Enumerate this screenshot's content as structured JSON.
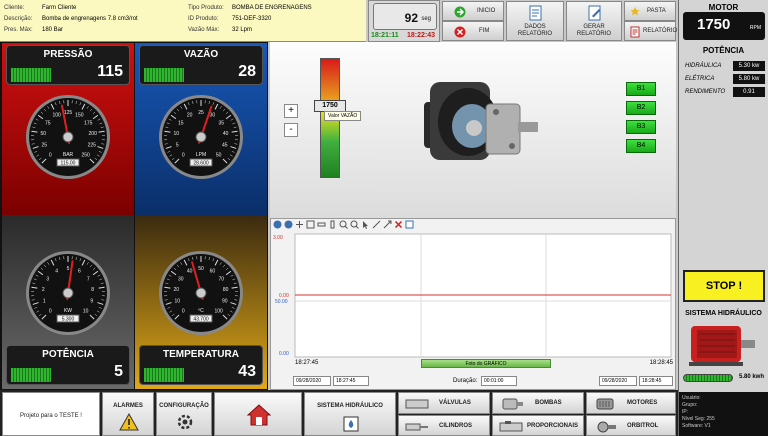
{
  "header": {
    "cliente_label": "Cliente:",
    "cliente": "Farm Cliente",
    "descricao_label": "Descrição:",
    "descricao": "Bomba de engrenagens 7.8 cm3/rot",
    "pres_label": "Pres. Máx:",
    "pres": "180 Bar",
    "tipo_label": "Tipo Produto:",
    "tipo": "BOMBA DE ENGRENAGENS",
    "id_label": "ID Produto:",
    "id": "751-DEF-3320",
    "vazao_label": "Vazão Máx:",
    "vazao": "32 Lpm"
  },
  "timer": {
    "value": "92",
    "unit": "seg",
    "start": "18:21:11",
    "end": "18:22:43"
  },
  "toolbar": {
    "inicio": "INICIO",
    "fim": "FIM",
    "dados": "DADOS\nRELATÓRIO",
    "gerar": "GERAR\nRELATÓRIO",
    "pasta": "PASTA",
    "relatorio": "RELATÓRIO"
  },
  "motor": {
    "title": "MOTOR",
    "rpm": "1750",
    "rpm_unit": "RPM",
    "potencia_title": "POTÊNCIA",
    "hidraulica_label": "HIDRÁULICA",
    "hidraulica": "5.30 kw",
    "eletrica_label": "ELÉTRICA",
    "eletrica": "5.80 kw",
    "rendimento_label": "RENDIMENTO",
    "rendimento": "0.91",
    "stop": "STOP !",
    "sistema_title": "SISTEMA HIDRÁULICO",
    "energia": "5.80 kwh",
    "info": [
      "Usuário:",
      "Grupo:",
      "IP:",
      "Nível Seg: 255",
      "Software: V1"
    ]
  },
  "gauges": {
    "pressao": {
      "name": "PRESSÃO",
      "value": "115",
      "unit": "BAR",
      "readout": "115.00",
      "ticks": [
        "0",
        "25",
        "50",
        "75",
        "100",
        "125",
        "150",
        "175",
        "200",
        "225",
        "250"
      ],
      "level": 0.46
    },
    "vazao": {
      "name": "VAZÃO",
      "value": "28",
      "unit": "LPM",
      "readout": "28.600",
      "ticks": [
        "0",
        "5",
        "10",
        "15",
        "20",
        "25",
        "30",
        "35",
        "40",
        "45",
        "50"
      ],
      "level": 0.57
    },
    "potencia": {
      "name": "POTÊNCIA",
      "value": "5",
      "unit": "KW",
      "readout": "5.300",
      "ticks": [
        "0",
        "1",
        "2",
        "3",
        "4",
        "5",
        "6",
        "7",
        "8",
        "9",
        "10"
      ],
      "level": 0.53
    },
    "temperatura": {
      "name": "TEMPERATURA",
      "value": "43",
      "unit": "ºC",
      "readout": "43.700",
      "ticks": [
        "0",
        "10",
        "20",
        "30",
        "40",
        "50",
        "60",
        "70",
        "80",
        "90",
        "100"
      ],
      "level": 0.44
    }
  },
  "center": {
    "slider_value": "1750",
    "tooltip": "Valor VAZÃO",
    "plus": "+",
    "minus": "-",
    "b_buttons": [
      "B1",
      "B2",
      "B3",
      "B4"
    ]
  },
  "chart": {
    "y_top": "3.00",
    "y_red": "0.00",
    "y_mid": "50.00",
    "y_bottom": "0.00",
    "x_start": "18:27:45",
    "x_end": "18:28:45",
    "foto": "Foto do GRÁFICO",
    "date_start": "09/28/2020",
    "time_start": "18:27:45",
    "duracao_label": "Duração:",
    "duracao": "00:01:00",
    "date_end": "09/28/2020",
    "time_end": "18:28:45"
  },
  "bottom": {
    "projeto": "Projeto para o TESTE !",
    "alarmes": "ALARMES",
    "configuracao": "CONFIGURAÇÃO",
    "sistema": "SISTEMA HIDRÁULICO",
    "valvulas": "VÁLVULAS",
    "cilindros": "CILINDROS",
    "bombas": "BOMBAS",
    "proporcionais": "PROPORCIONAIS",
    "motores": "MOTORES",
    "orbitrol": "ORBITROL"
  }
}
